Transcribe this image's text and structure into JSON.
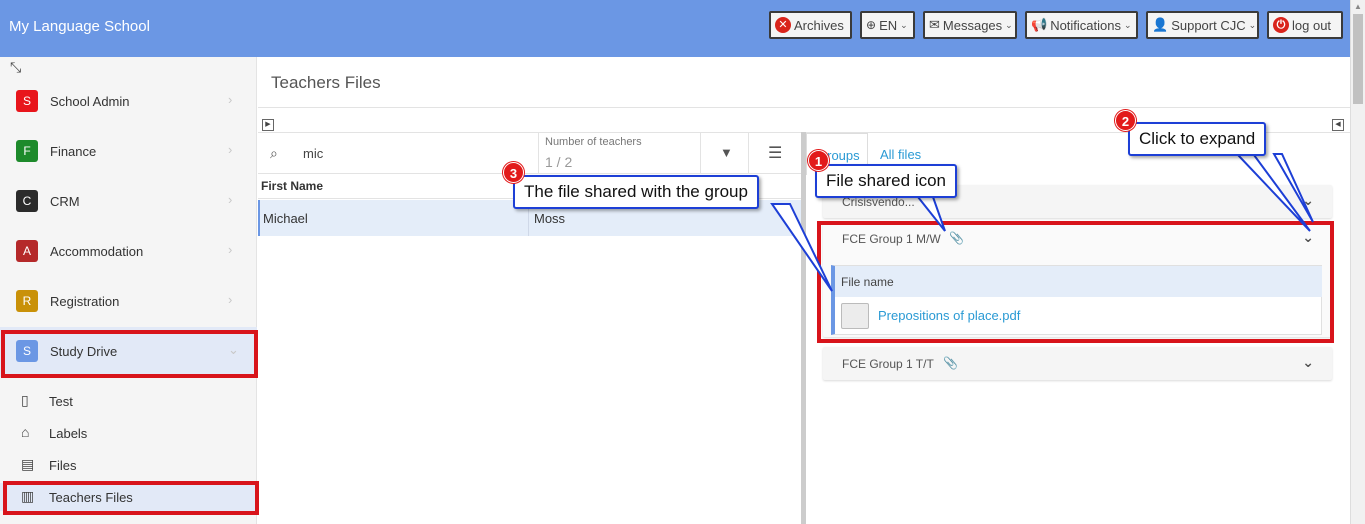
{
  "topbar": {
    "brand": "My Language School",
    "buttons": {
      "archives": "Archives",
      "lang": "EN",
      "messages": "Messages",
      "notifications": "Notifications",
      "support": "Support CJC",
      "logout": "log out"
    }
  },
  "sidebar": {
    "modules": [
      {
        "letter": "S",
        "label": "School Admin",
        "color": "#e8151b"
      },
      {
        "letter": "F",
        "label": "Finance",
        "color": "#1d8a2b"
      },
      {
        "letter": "C",
        "label": "CRM",
        "color": "#2b2b2b"
      },
      {
        "letter": "A",
        "label": "Accommodation",
        "color": "#b5292a"
      },
      {
        "letter": "R",
        "label": "Registration",
        "color": "#c99108"
      },
      {
        "letter": "S",
        "label": "Study Drive",
        "color": "#6b97e4"
      }
    ],
    "sub_items": [
      "Test",
      "Labels",
      "Files",
      "Teachers Files"
    ]
  },
  "main": {
    "title": "Teachers Files",
    "search": {
      "value": "mic"
    },
    "count": {
      "label": "Number of teachers",
      "value": "1 / 2"
    },
    "columns": {
      "first_name": "First Name"
    },
    "rows": [
      {
        "first": "Michael",
        "last": "Moss"
      }
    ]
  },
  "right": {
    "tabs": {
      "groups": "Groups",
      "all": "All files"
    },
    "groups": [
      "Crisisvendo...",
      "FCE Group 1 M/W",
      "FCE Group 1 T/T"
    ],
    "files_header": "File name",
    "file": "Prepositions of place.pdf"
  },
  "callouts": {
    "c1": {
      "num": "1",
      "text": "File shared icon"
    },
    "c2": {
      "num": "2",
      "text": "Click to expand"
    },
    "c3": {
      "num": "3",
      "text": "The file shared with the group"
    }
  },
  "colors": {
    "accent": "#6b97e4",
    "highlight": "#d8141b",
    "callout_border": "#1d3fd6"
  }
}
